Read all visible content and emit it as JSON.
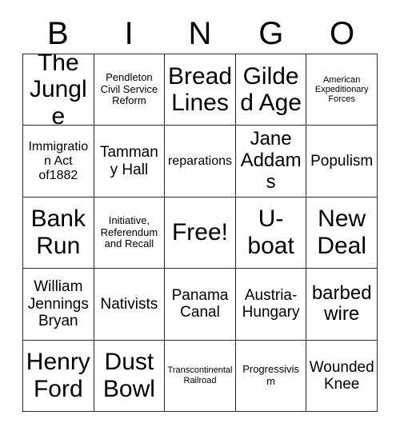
{
  "header": {
    "letters": [
      "B",
      "I",
      "N",
      "G",
      "O"
    ]
  },
  "grid": {
    "rows": 5,
    "columns": 5,
    "border_color": "#2b2b2b",
    "background_color": "#ffffff",
    "text_color": "#000000",
    "cells": [
      {
        "text": "The Jungle",
        "size": "xxl"
      },
      {
        "text": "Pendleton Civil Service Reform",
        "size": "xs"
      },
      {
        "text": "Bread Lines",
        "size": "xxl"
      },
      {
        "text": "Gilded Age",
        "size": "xxl"
      },
      {
        "text": "American Expeditionary Forces",
        "size": "xxs"
      },
      {
        "text": "Immigration Act of1882",
        "size": "sm"
      },
      {
        "text": "Tammany Hall",
        "size": "md"
      },
      {
        "text": "reparations",
        "size": "sm"
      },
      {
        "text": "Jane Addams",
        "size": "lg"
      },
      {
        "text": "Populism",
        "size": "md"
      },
      {
        "text": "Bank Run",
        "size": "xxl"
      },
      {
        "text": "Initiative, Referendum and Recall",
        "size": "xs"
      },
      {
        "text": "Free!",
        "size": "xxl"
      },
      {
        "text": "U-boat",
        "size": "xxl"
      },
      {
        "text": "New Deal",
        "size": "xxl"
      },
      {
        "text": "William Jennings Bryan",
        "size": "md"
      },
      {
        "text": "Nativists",
        "size": "md"
      },
      {
        "text": "Panama Canal",
        "size": "md"
      },
      {
        "text": "Austria-Hungary",
        "size": "md"
      },
      {
        "text": "barbed wire",
        "size": "lg"
      },
      {
        "text": "Henry Ford",
        "size": "xxl"
      },
      {
        "text": "Dust Bowl",
        "size": "xxl"
      },
      {
        "text": "Transcontinental Railroad",
        "size": "xxs"
      },
      {
        "text": "Progressivism",
        "size": "xs"
      },
      {
        "text": "Wounded Knee",
        "size": "md"
      }
    ]
  }
}
